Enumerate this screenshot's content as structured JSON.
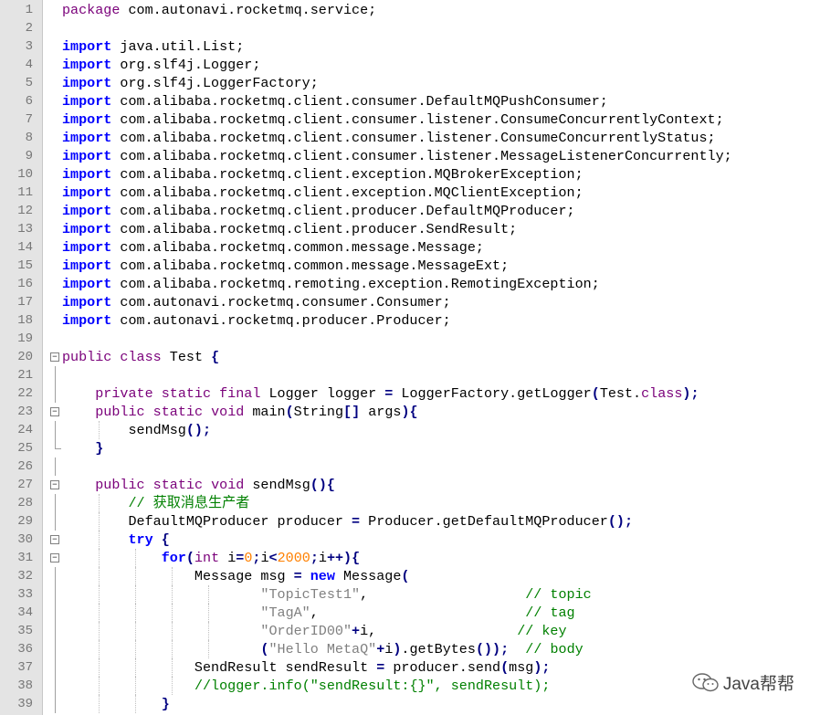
{
  "editor": {
    "lines": [
      {
        "n": "1",
        "tokens": [
          [
            "mod",
            "package"
          ],
          [
            "t",
            " com.autonavi.rocketmq.service;"
          ]
        ]
      },
      {
        "n": "2",
        "tokens": []
      },
      {
        "n": "3",
        "tokens": [
          [
            "kw",
            "import"
          ],
          [
            "t",
            " java.util.List;"
          ]
        ]
      },
      {
        "n": "4",
        "tokens": [
          [
            "kw",
            "import"
          ],
          [
            "t",
            " org.slf4j.Logger;"
          ]
        ]
      },
      {
        "n": "5",
        "tokens": [
          [
            "kw",
            "import"
          ],
          [
            "t",
            " org.slf4j.LoggerFactory;"
          ]
        ]
      },
      {
        "n": "6",
        "tokens": [
          [
            "kw",
            "import"
          ],
          [
            "t",
            " com.alibaba.rocketmq.client.consumer.DefaultMQPushConsumer;"
          ]
        ]
      },
      {
        "n": "7",
        "tokens": [
          [
            "kw",
            "import"
          ],
          [
            "t",
            " com.alibaba.rocketmq.client.consumer.listener.ConsumeConcurrentlyContext;"
          ]
        ]
      },
      {
        "n": "8",
        "tokens": [
          [
            "kw",
            "import"
          ],
          [
            "t",
            " com.alibaba.rocketmq.client.consumer.listener.ConsumeConcurrentlyStatus;"
          ]
        ]
      },
      {
        "n": "9",
        "tokens": [
          [
            "kw",
            "import"
          ],
          [
            "t",
            " com.alibaba.rocketmq.client.consumer.listener.MessageListenerConcurrently;"
          ]
        ]
      },
      {
        "n": "10",
        "tokens": [
          [
            "kw",
            "import"
          ],
          [
            "t",
            " com.alibaba.rocketmq.client.exception.MQBrokerException;"
          ]
        ]
      },
      {
        "n": "11",
        "tokens": [
          [
            "kw",
            "import"
          ],
          [
            "t",
            " com.alibaba.rocketmq.client.exception.MQClientException;"
          ]
        ]
      },
      {
        "n": "12",
        "tokens": [
          [
            "kw",
            "import"
          ],
          [
            "t",
            " com.alibaba.rocketmq.client.producer.DefaultMQProducer;"
          ]
        ]
      },
      {
        "n": "13",
        "tokens": [
          [
            "kw",
            "import"
          ],
          [
            "t",
            " com.alibaba.rocketmq.client.producer.SendResult;"
          ]
        ]
      },
      {
        "n": "14",
        "tokens": [
          [
            "kw",
            "import"
          ],
          [
            "t",
            " com.alibaba.rocketmq.common.message.Message;"
          ]
        ]
      },
      {
        "n": "15",
        "tokens": [
          [
            "kw",
            "import"
          ],
          [
            "t",
            " com.alibaba.rocketmq.common.message.MessageExt;"
          ]
        ]
      },
      {
        "n": "16",
        "tokens": [
          [
            "kw",
            "import"
          ],
          [
            "t",
            " com.alibaba.rocketmq.remoting.exception.RemotingException;"
          ]
        ]
      },
      {
        "n": "17",
        "tokens": [
          [
            "kw",
            "import"
          ],
          [
            "t",
            " com.autonavi.rocketmq.consumer.Consumer;"
          ]
        ]
      },
      {
        "n": "18",
        "tokens": [
          [
            "kw",
            "import"
          ],
          [
            "t",
            " com.autonavi.rocketmq.producer.Producer;"
          ]
        ]
      },
      {
        "n": "19",
        "tokens": []
      },
      {
        "n": "20",
        "tokens": [
          [
            "mod",
            "public"
          ],
          [
            "t",
            " "
          ],
          [
            "mod",
            "class"
          ],
          [
            "t",
            " Test "
          ],
          [
            "op",
            "{"
          ]
        ]
      },
      {
        "n": "21",
        "tokens": []
      },
      {
        "n": "22",
        "tokens": [
          [
            "t",
            "    "
          ],
          [
            "mod",
            "private"
          ],
          [
            "t",
            " "
          ],
          [
            "mod",
            "static"
          ],
          [
            "t",
            " "
          ],
          [
            "mod",
            "final"
          ],
          [
            "t",
            " Logger logger "
          ],
          [
            "op",
            "="
          ],
          [
            "t",
            " LoggerFactory.getLogger"
          ],
          [
            "op",
            "("
          ],
          [
            "t",
            "Test."
          ],
          [
            "mod",
            "class"
          ],
          [
            "op",
            ");"
          ]
        ]
      },
      {
        "n": "23",
        "tokens": [
          [
            "t",
            "    "
          ],
          [
            "mod",
            "public"
          ],
          [
            "t",
            " "
          ],
          [
            "mod",
            "static"
          ],
          [
            "t",
            " "
          ],
          [
            "mod",
            "void"
          ],
          [
            "t",
            " main"
          ],
          [
            "op",
            "("
          ],
          [
            "t",
            "String"
          ],
          [
            "op",
            "[]"
          ],
          [
            "t",
            " args"
          ],
          [
            "op",
            "){"
          ]
        ]
      },
      {
        "n": "24",
        "tokens": [
          [
            "t",
            "        sendMsg"
          ],
          [
            "op",
            "();"
          ]
        ]
      },
      {
        "n": "25",
        "tokens": [
          [
            "t",
            "    "
          ],
          [
            "op",
            "}"
          ]
        ]
      },
      {
        "n": "26",
        "tokens": []
      },
      {
        "n": "27",
        "tokens": [
          [
            "t",
            "    "
          ],
          [
            "mod",
            "public"
          ],
          [
            "t",
            " "
          ],
          [
            "mod",
            "static"
          ],
          [
            "t",
            " "
          ],
          [
            "mod",
            "void"
          ],
          [
            "t",
            " sendMsg"
          ],
          [
            "op",
            "(){"
          ]
        ]
      },
      {
        "n": "28",
        "tokens": [
          [
            "t",
            "        "
          ],
          [
            "cmt",
            "// 获取消息生产者"
          ]
        ]
      },
      {
        "n": "29",
        "tokens": [
          [
            "t",
            "        DefaultMQProducer producer "
          ],
          [
            "op",
            "="
          ],
          [
            "t",
            " Producer.getDefaultMQProducer"
          ],
          [
            "op",
            "();"
          ]
        ]
      },
      {
        "n": "30",
        "tokens": [
          [
            "t",
            "        "
          ],
          [
            "kw",
            "try"
          ],
          [
            "t",
            " "
          ],
          [
            "op",
            "{"
          ]
        ]
      },
      {
        "n": "31",
        "tokens": [
          [
            "t",
            "            "
          ],
          [
            "kw",
            "for"
          ],
          [
            "op",
            "("
          ],
          [
            "type",
            "int"
          ],
          [
            "t",
            " i"
          ],
          [
            "op",
            "="
          ],
          [
            "num",
            "0"
          ],
          [
            "op",
            ";"
          ],
          [
            "t",
            "i"
          ],
          [
            "op",
            "<"
          ],
          [
            "num",
            "2000"
          ],
          [
            "op",
            ";"
          ],
          [
            "t",
            "i"
          ],
          [
            "op",
            "++){"
          ]
        ]
      },
      {
        "n": "32",
        "tokens": [
          [
            "t",
            "                Message msg "
          ],
          [
            "op",
            "="
          ],
          [
            "t",
            " "
          ],
          [
            "kw",
            "new"
          ],
          [
            "t",
            " Message"
          ],
          [
            "op",
            "("
          ]
        ]
      },
      {
        "n": "33",
        "tokens": [
          [
            "t",
            "                        "
          ],
          [
            "str",
            "\"TopicTest1\""
          ],
          [
            "t",
            ",                   "
          ],
          [
            "cmt",
            "// topic"
          ]
        ]
      },
      {
        "n": "34",
        "tokens": [
          [
            "t",
            "                        "
          ],
          [
            "str",
            "\"TagA\""
          ],
          [
            "t",
            ",                         "
          ],
          [
            "cmt",
            "// tag"
          ]
        ]
      },
      {
        "n": "35",
        "tokens": [
          [
            "t",
            "                        "
          ],
          [
            "str",
            "\"OrderID00\""
          ],
          [
            "op",
            "+"
          ],
          [
            "t",
            "i,                 "
          ],
          [
            "cmt",
            "// key"
          ]
        ]
      },
      {
        "n": "36",
        "tokens": [
          [
            "t",
            "                        "
          ],
          [
            "op",
            "("
          ],
          [
            "str",
            "\"Hello MetaQ\""
          ],
          [
            "op",
            "+"
          ],
          [
            "t",
            "i"
          ],
          [
            "op",
            ")"
          ],
          [
            "t",
            ".getBytes"
          ],
          [
            "op",
            "());"
          ],
          [
            "t",
            "  "
          ],
          [
            "cmt",
            "// body"
          ]
        ]
      },
      {
        "n": "37",
        "tokens": [
          [
            "t",
            "                SendResult sendResult "
          ],
          [
            "op",
            "="
          ],
          [
            "t",
            " producer.send"
          ],
          [
            "op",
            "("
          ],
          [
            "t",
            "msg"
          ],
          [
            "op",
            ");"
          ]
        ]
      },
      {
        "n": "38",
        "tokens": [
          [
            "t",
            "                "
          ],
          [
            "cmt",
            "//logger.info(\"sendResult:{}\", sendResult);"
          ]
        ]
      },
      {
        "n": "39",
        "tokens": [
          [
            "t",
            "            "
          ],
          [
            "op",
            "}"
          ]
        ]
      }
    ]
  },
  "watermark": {
    "label": "Java帮帮",
    "icon": "wechat-icon"
  },
  "colors": {
    "keyword": "#0000ff",
    "modifier": "#7a007a",
    "number": "#ff8000",
    "string": "#808080",
    "comment": "#008000",
    "gutter": "#e4e4e4"
  }
}
